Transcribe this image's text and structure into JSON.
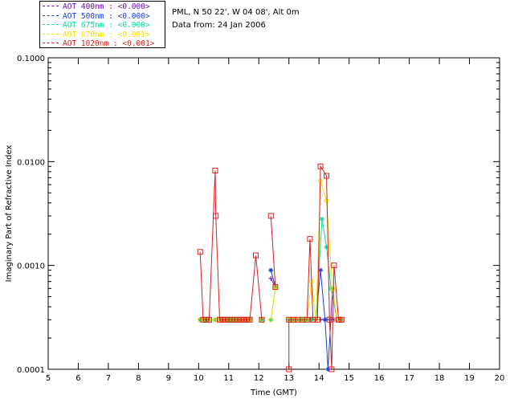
{
  "legend": [
    {
      "label": "AOT  400nm : <0.000>",
      "color": "#6a0dad"
    },
    {
      "label": "AOT  500nm : <0.000>",
      "color": "#1a3fd6"
    },
    {
      "label": "AOT  675nm : <0.000>",
      "color": "#10d8a0"
    },
    {
      "label": "AOT  870nm : <0.001>",
      "color": "#f2e200"
    },
    {
      "label": "AOT 1020nm : <0.001>",
      "color": "#d42020"
    }
  ],
  "info": {
    "site": "PML, N 50 22', W 04 08', Alt 0m",
    "date": "Data from: 24 Jan 2006"
  },
  "chart_data": {
    "type": "line",
    "title": "",
    "xlabel": "Time (GMT)",
    "ylabel": "Imaginary Part of Refractive Index",
    "xlim": [
      5,
      20
    ],
    "ylim": [
      0.0001,
      0.1
    ],
    "yscale": "log",
    "xticks": [
      "5",
      "6",
      "7",
      "8",
      "9",
      "10",
      "11",
      "12",
      "13",
      "14",
      "15",
      "16",
      "17",
      "18",
      "19",
      "20"
    ],
    "yticks": [
      "0.0001",
      "0.0010",
      "0.0100",
      "0.1000"
    ],
    "grid": false,
    "legend_position": "top-left outside",
    "series": [
      {
        "name": "AOT  400nm : <0.000>",
        "color": "#6a0dad",
        "marker": "plus",
        "points": [
          [
            10.05,
            0.0003
          ],
          [
            10.15,
            0.0003
          ],
          [
            10.25,
            0.0003
          ],
          [
            10.35,
            0.0003
          ],
          [
            10.55,
            0.0003
          ],
          [
            10.7,
            0.0003
          ],
          [
            10.8,
            0.0003
          ],
          [
            10.9,
            0.0003
          ],
          [
            11.0,
            0.0003
          ],
          [
            11.1,
            0.0003
          ],
          [
            11.2,
            0.0003
          ],
          [
            11.3,
            0.0003
          ],
          [
            11.4,
            0.0003
          ],
          [
            11.5,
            0.0003
          ],
          [
            11.6,
            0.0003
          ],
          [
            11.7,
            0.0003
          ],
          [
            12.1,
            0.0003
          ],
          [
            12.4,
            0.00075
          ],
          [
            12.55,
            0.00062
          ],
          [
            13.0,
            0.0003
          ],
          [
            13.15,
            0.0003
          ],
          [
            13.3,
            0.0003
          ],
          [
            13.45,
            0.0003
          ],
          [
            13.6,
            0.0003
          ],
          [
            13.75,
            0.0003
          ],
          [
            13.9,
            0.0003
          ],
          [
            14.05,
            0.0003
          ],
          [
            14.2,
            0.0003
          ],
          [
            14.35,
            0.0003
          ],
          [
            14.5,
            0.0003
          ],
          [
            14.6,
            0.0003
          ],
          [
            14.75,
            0.0003
          ]
        ]
      },
      {
        "name": "AOT  500nm : <0.000>",
        "color": "#1a3fd6",
        "marker": "asterisk",
        "points": [
          [
            10.05,
            0.0003
          ],
          [
            10.15,
            0.0003
          ],
          [
            10.25,
            0.0003
          ],
          [
            10.35,
            0.0003
          ],
          [
            10.55,
            0.0003
          ],
          [
            10.7,
            0.0003
          ],
          [
            10.8,
            0.0003
          ],
          [
            10.9,
            0.0003
          ],
          [
            11.0,
            0.0003
          ],
          [
            11.1,
            0.0003
          ],
          [
            11.2,
            0.0003
          ],
          [
            11.3,
            0.0003
          ],
          [
            11.4,
            0.0003
          ],
          [
            11.5,
            0.0003
          ],
          [
            11.6,
            0.0003
          ],
          [
            11.7,
            0.0003
          ],
          [
            12.1,
            0.0003
          ],
          [
            12.4,
            0.0009
          ],
          [
            12.55,
            0.00062
          ],
          [
            13.0,
            0.0003
          ],
          [
            13.15,
            0.0003
          ],
          [
            13.3,
            0.0003
          ],
          [
            13.45,
            0.0003
          ],
          [
            13.6,
            0.0003
          ],
          [
            13.75,
            0.0003
          ],
          [
            13.9,
            0.0003
          ],
          [
            14.05,
            0.0009
          ],
          [
            14.2,
            0.0003
          ],
          [
            14.3,
            0.0001
          ],
          [
            14.45,
            0.0006
          ],
          [
            14.6,
            0.0003
          ],
          [
            14.75,
            0.0003
          ]
        ]
      },
      {
        "name": "AOT  675nm : <0.000>",
        "color": "#10d8a0",
        "marker": "star",
        "points": [
          [
            10.05,
            0.0003
          ],
          [
            10.15,
            0.0003
          ],
          [
            10.25,
            0.0003
          ],
          [
            10.35,
            0.0003
          ],
          [
            10.55,
            0.0003
          ],
          [
            10.7,
            0.0003
          ],
          [
            10.8,
            0.0003
          ],
          [
            10.9,
            0.0003
          ],
          [
            11.0,
            0.0003
          ],
          [
            11.1,
            0.0003
          ],
          [
            11.2,
            0.0003
          ],
          [
            11.3,
            0.0003
          ],
          [
            11.4,
            0.0003
          ],
          [
            11.5,
            0.0003
          ],
          [
            11.6,
            0.0003
          ],
          [
            11.7,
            0.0003
          ],
          [
            12.1,
            0.0003
          ],
          [
            12.4,
            0.0003
          ],
          [
            12.55,
            0.00062
          ],
          [
            13.0,
            0.0003
          ],
          [
            13.15,
            0.0003
          ],
          [
            13.3,
            0.0003
          ],
          [
            13.45,
            0.0003
          ],
          [
            13.6,
            0.0003
          ],
          [
            13.75,
            0.0003
          ],
          [
            13.9,
            0.0003
          ],
          [
            14.1,
            0.0028
          ],
          [
            14.25,
            0.0015
          ],
          [
            14.4,
            0.0006
          ],
          [
            14.6,
            0.0003
          ],
          [
            14.75,
            0.0003
          ]
        ]
      },
      {
        "name": "AOT  870nm : <0.001>",
        "color": "#f2e200",
        "marker": "diamond",
        "points": [
          [
            10.05,
            0.0003
          ],
          [
            10.15,
            0.0003
          ],
          [
            10.25,
            0.0003
          ],
          [
            10.35,
            0.0003
          ],
          [
            10.55,
            0.0003
          ],
          [
            10.7,
            0.0003
          ],
          [
            10.8,
            0.0003
          ],
          [
            10.9,
            0.0003
          ],
          [
            11.0,
            0.0003
          ],
          [
            11.1,
            0.0003
          ],
          [
            11.2,
            0.0003
          ],
          [
            11.3,
            0.0003
          ],
          [
            11.4,
            0.0003
          ],
          [
            11.5,
            0.0003
          ],
          [
            11.6,
            0.0003
          ],
          [
            11.7,
            0.0003
          ],
          [
            12.1,
            0.0003
          ],
          [
            12.4,
            0.0003
          ],
          [
            12.55,
            0.00062
          ],
          [
            13.0,
            0.0003
          ],
          [
            13.15,
            0.0003
          ],
          [
            13.3,
            0.0003
          ],
          [
            13.45,
            0.0003
          ],
          [
            13.6,
            0.0003
          ],
          [
            13.75,
            0.0007
          ],
          [
            13.9,
            0.0003
          ],
          [
            14.05,
            0.0065
          ],
          [
            14.25,
            0.0042
          ],
          [
            14.45,
            0.0006
          ],
          [
            14.6,
            0.0003
          ],
          [
            14.75,
            0.0003
          ]
        ]
      },
      {
        "name": "AOT 1020nm : <0.001>",
        "color": "#d42020",
        "marker": "square",
        "points": [
          [
            10.05,
            0.00135
          ],
          [
            10.15,
            0.0003
          ],
          [
            10.25,
            0.0003
          ],
          [
            10.35,
            0.0003
          ],
          [
            10.55,
            0.0082
          ],
          [
            10.57,
            0.003
          ],
          [
            10.7,
            0.0003
          ],
          [
            10.8,
            0.0003
          ],
          [
            10.9,
            0.0003
          ],
          [
            11.0,
            0.0003
          ],
          [
            11.1,
            0.0003
          ],
          [
            11.2,
            0.0003
          ],
          [
            11.3,
            0.0003
          ],
          [
            11.4,
            0.0003
          ],
          [
            11.5,
            0.0003
          ],
          [
            11.6,
            0.0003
          ],
          [
            11.7,
            0.0003
          ],
          [
            11.9,
            0.00125
          ],
          [
            12.1,
            0.0003
          ],
          [
            12.4,
            0.003
          ],
          [
            12.55,
            0.00062
          ],
          [
            13.0,
            0.0001
          ],
          [
            13.0,
            0.0003
          ],
          [
            13.15,
            0.0003
          ],
          [
            13.3,
            0.0003
          ],
          [
            13.45,
            0.0003
          ],
          [
            13.6,
            0.0003
          ],
          [
            13.7,
            0.0018
          ],
          [
            13.8,
            0.0003
          ],
          [
            13.95,
            0.0003
          ],
          [
            14.05,
            0.009
          ],
          [
            14.25,
            0.0073
          ],
          [
            14.35,
            0.0003
          ],
          [
            14.42,
            0.0001
          ],
          [
            14.5,
            0.001
          ],
          [
            14.65,
            0.0003
          ],
          [
            14.75,
            0.0003
          ]
        ]
      }
    ]
  }
}
